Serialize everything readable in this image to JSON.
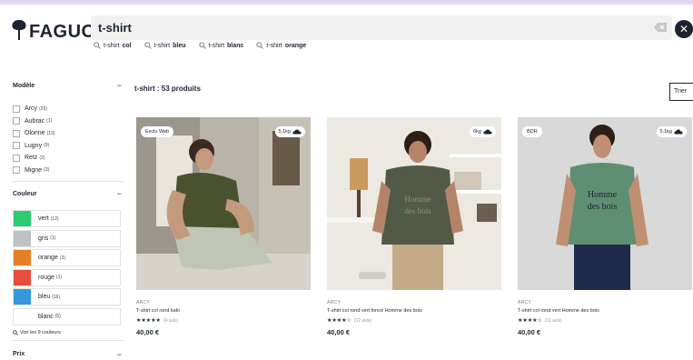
{
  "header": {
    "logo_text": "FAGUO",
    "search": {
      "value": "t-shirt"
    },
    "suggestions": [
      {
        "prefix": "t-shirt",
        "bold": "col"
      },
      {
        "prefix": "t-shirt",
        "bold": "bleu"
      },
      {
        "prefix": "t-shirt",
        "bold": "blanc"
      },
      {
        "prefix": "t-shirt",
        "bold": "orange"
      }
    ],
    "close_glyph": "✕"
  },
  "filters": {
    "model": {
      "title": "Modèle",
      "items": [
        {
          "label": "Arcy",
          "count": "(25)"
        },
        {
          "label": "Aubrac",
          "count": "(1)"
        },
        {
          "label": "Olonne",
          "count": "(13)"
        },
        {
          "label": "Lugny",
          "count": "(9)"
        },
        {
          "label": "Retz",
          "count": "(2)"
        },
        {
          "label": "Migne",
          "count": "(3)"
        }
      ]
    },
    "color": {
      "title": "Couleur",
      "items": [
        {
          "label": "vert",
          "count": "(12)",
          "swatch": "#2ecc71"
        },
        {
          "label": "gris",
          "count": "(1)",
          "swatch": "#bfc1c2"
        },
        {
          "label": "orange",
          "count": "(3)",
          "swatch": "#e67e22"
        },
        {
          "label": "rouge",
          "count": "(1)",
          "swatch": "#e74c3c"
        },
        {
          "label": "bleu",
          "count": "(16)",
          "swatch": "#3498db"
        },
        {
          "label": "blanc",
          "count": "(5)",
          "swatch": "#ffffff"
        }
      ],
      "see_all": "Voir les 9 couleurs"
    },
    "price": {
      "title": "Prix"
    },
    "collapse_glyph": "−"
  },
  "results": {
    "count_label": "t-shirt : 53 produits",
    "sort_label": "Trier"
  },
  "products": [
    {
      "badge": "Exclu Web",
      "co2": "5,1kg",
      "brand": "ARCY",
      "name": "T-shirt col rond kaki",
      "stars": "★★★★★",
      "reviews": "(4 avis)",
      "price": "40,00 €"
    },
    {
      "badge": "",
      "co2": "6kg",
      "brand": "ARCY",
      "name": "T-shirt col rond vert foncé Homme des bois",
      "stars": "★★★★☆",
      "reviews": "(12 avis)",
      "price": "40,00 €"
    },
    {
      "badge": "BDR",
      "co2": "5,1kg",
      "brand": "ARCY",
      "name": "T-shirt col rond vert Homme des bois",
      "stars": "★★★★☆",
      "reviews": "(11 avis)",
      "price": "40,00 €"
    }
  ],
  "print_text": "Homme\ndes bois",
  "colors": {
    "text": "#1c2332",
    "frame": "#e7d6f0"
  }
}
